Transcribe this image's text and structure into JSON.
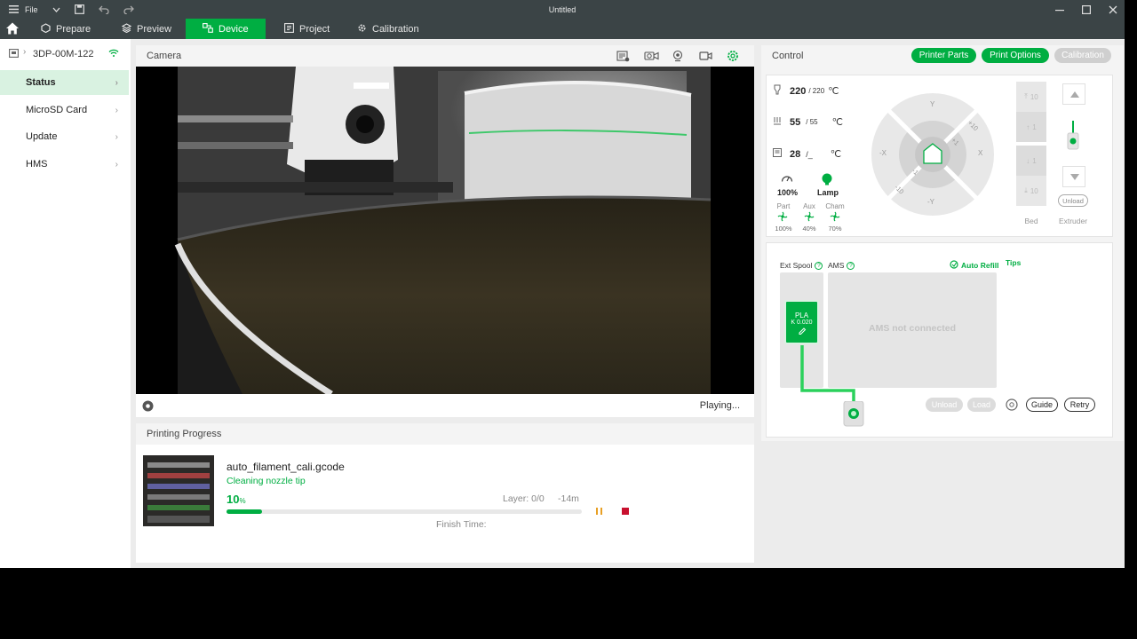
{
  "titlebar": {
    "file_label": "File",
    "title": "Untitled"
  },
  "nav": {
    "tabs": [
      {
        "label": "Prepare"
      },
      {
        "label": "Preview"
      },
      {
        "label": "Device"
      },
      {
        "label": "Project"
      },
      {
        "label": "Calibration"
      }
    ],
    "active_tab": "Device"
  },
  "sidebar": {
    "device_name": "3DP-00M-122",
    "items": [
      {
        "label": "Status"
      },
      {
        "label": "MicroSD Card"
      },
      {
        "label": "Update"
      },
      {
        "label": "HMS"
      }
    ]
  },
  "camera": {
    "title": "Camera",
    "status": "Playing...",
    "icons": [
      "sd-record-icon",
      "timelapse-icon",
      "webcam-icon",
      "video-icon",
      "settings-icon"
    ]
  },
  "progress": {
    "title": "Printing Progress",
    "file_name": "auto_filament_cali.gcode",
    "stage": "Cleaning nozzle tip",
    "percent_value": "10",
    "percent_unit": "%",
    "percent_fraction": 0.1,
    "layer": "Layer: 0/0",
    "time_left": "-14m",
    "finish_time": "Finish Time:"
  },
  "control": {
    "title": "Control",
    "buttons": {
      "printer_parts": "Printer Parts",
      "print_options": "Print Options",
      "calibration": "Calibration"
    },
    "temps": {
      "nozzle_current": "220",
      "nozzle_target": "/ 220",
      "bed_current": "55",
      "bed_target": "/ 55",
      "chamber_current": "28",
      "chamber_target": "/_",
      "unit": "℃"
    },
    "speed": {
      "value": "100%"
    },
    "lamp": {
      "label": "Lamp"
    },
    "fans": [
      {
        "name": "Part",
        "value": "100%"
      },
      {
        "name": "Aux",
        "value": "40%"
      },
      {
        "name": "Cham",
        "value": "70%"
      }
    ],
    "jog": {
      "y_plus": "Y",
      "y_minus": "-Y",
      "x_plus": "X",
      "x_minus": "-X",
      "plus10": "+10",
      "plus1": "+1",
      "minus1": "-1",
      "minus10": "-10"
    },
    "bed": {
      "up10": "10",
      "up1": "1",
      "down1": "1",
      "down10": "10",
      "label": "Bed"
    },
    "extruder": {
      "unload": "Unload",
      "label": "Extruder"
    }
  },
  "ams": {
    "ext_spool_label": "Ext Spool",
    "ams_label": "AMS",
    "help": "?",
    "auto_refill": "Auto Refill",
    "tips": "Tips",
    "not_connected": "AMS not connected",
    "spool_material": "PLA",
    "spool_k": "K 0.020",
    "unload": "Unload",
    "load": "Load",
    "guide": "Guide",
    "retry": "Retry"
  },
  "colors": {
    "accent": "#00ae42",
    "titlebar": "#3b4446",
    "pause": "#e8a025",
    "stop": "#c8102e"
  }
}
